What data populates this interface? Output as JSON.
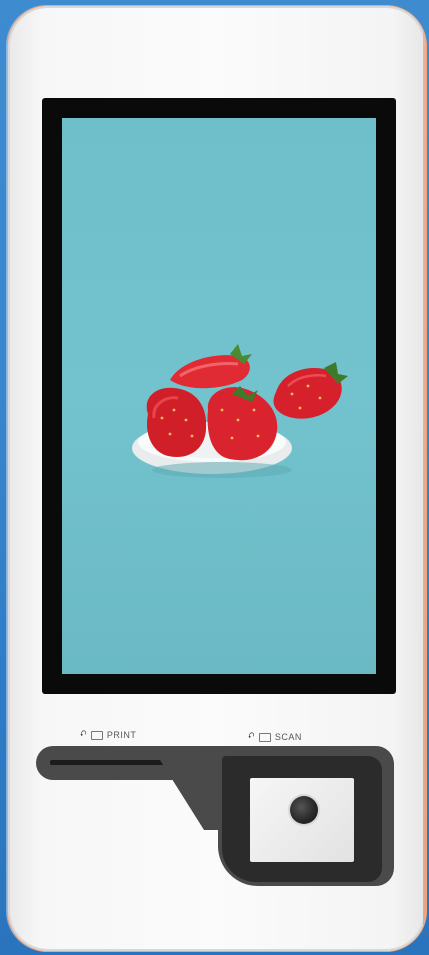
{
  "kiosk": {
    "print_label": "PRINT",
    "scan_label": "SCAN"
  },
  "icons": {
    "chevron": "chevron-down-icon",
    "printer": "printer-icon",
    "scanner": "scanner-icon"
  },
  "colors": {
    "screen_background": "#6fbfcb",
    "kiosk_body": "#f7f7f7",
    "bezel": "#0a0a0a",
    "strawberry": "#d6202b",
    "housing": "#4a4a4a"
  }
}
